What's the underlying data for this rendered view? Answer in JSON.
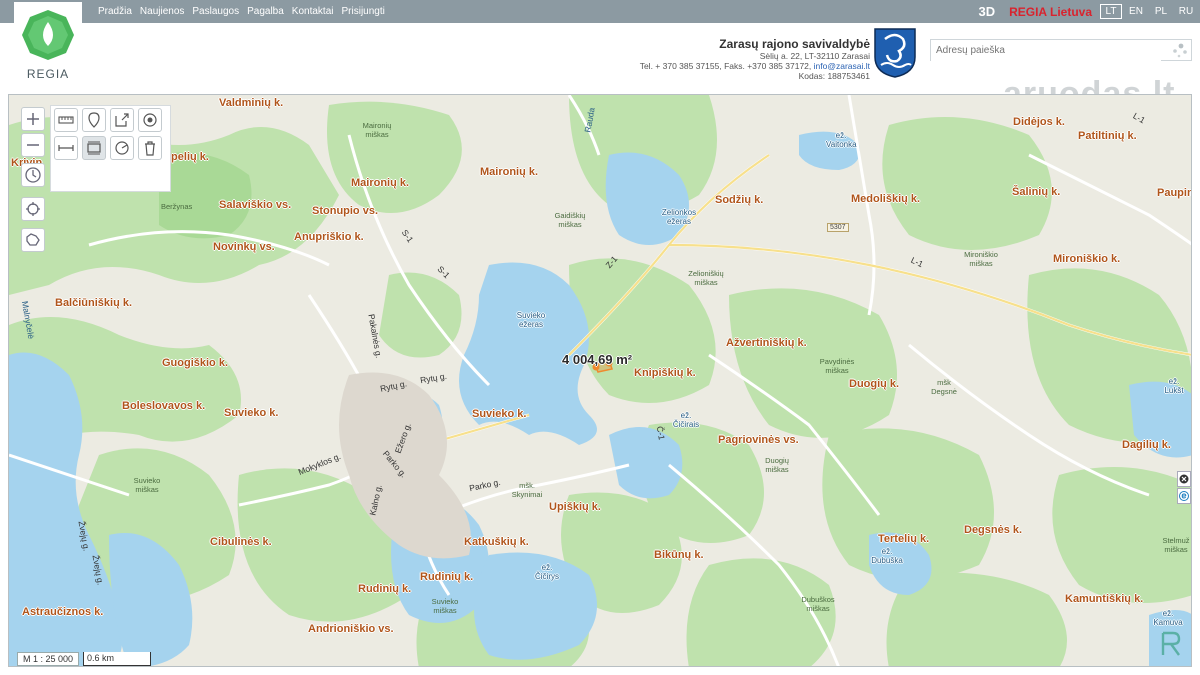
{
  "topbar": {
    "nav": [
      "Pradžia",
      "Naujienos",
      "Paslaugos",
      "Pagalba",
      "Kontaktai",
      "Prisijungti"
    ],
    "view_3d": "3D",
    "brand": "REGIA Lietuva",
    "languages": [
      "LT",
      "EN",
      "PL",
      "RU"
    ],
    "active_language": "LT"
  },
  "logo": {
    "text": "REGIA"
  },
  "municipality": {
    "name": "Zarasų rajono savivaldybė",
    "address": "Sėlių a. 22, LT-32110 Zarasai",
    "phone_prefix": "Tel. + 370 385 37155, Faks. +370 385 37172,",
    "email": "info@zarasai.lt",
    "code": "Kodas: 188753461"
  },
  "search": {
    "placeholder": "Adresų paieška"
  },
  "watermark": "aruodas.lt",
  "map": {
    "area_measurement": "4 004,69 m²",
    "scale_text": "M 1 : 25 000",
    "scale_bar": "0.6 km",
    "village_labels": [
      "Valdminių k.",
      "Krivin",
      "Pupelių k.",
      "Maironių k.",
      "Maironių k.",
      "Salaviškio vs.",
      "Stonupio vs.",
      "Novinkų vs.",
      "Anupriškio k.",
      "Sodžių k.",
      "Medoliškių k.",
      "Didėjos k.",
      "Patiltinių k.",
      "Šalinių k.",
      "Paupin",
      "Mironiškio k.",
      "Balčiūniškių k.",
      "Guogiškio k.",
      "Knipiškių k.",
      "Ažvertiniškių k.",
      "Duogių k.",
      "Boleslovavos k.",
      "Suvieko k.",
      "Suvieko k.",
      "Pagriovinės vs.",
      "Dagilių k.",
      "Upiškių k.",
      "Degsnės k.",
      "Tertelių k.",
      "Cibulinės k.",
      "Katkuškių k.",
      "Bikūnų k.",
      "Rudinių k.",
      "Rudinių k.",
      "Astraučiznos k.",
      "Andrioniškio vs.",
      "Kamuntiškių k."
    ],
    "water_labels": [
      "Suvieko ežeras",
      "Zelionkos ežeras",
      "ež. Vaitonka",
      "ež. Čičirais",
      "ež. Čičirys",
      "ež. Dubuška",
      "ež. Lukšt",
      "ež. Kamuva"
    ],
    "forest_labels": [
      "Maironių miškas",
      "Gaidiškių miškas",
      "Zelioniškių miškas",
      "Beržynas",
      "Mironiškio miškas",
      "Pavydinės miškas",
      "mšk Degsnė",
      "Duogių miškas",
      "mšk. Skynimai",
      "Suvieko miškas",
      "Suvieko miškas",
      "Dubuškos miškas",
      "Stelmuž miškas"
    ],
    "road_labels": [
      "Pakalnės g.",
      "Rytų g.",
      "Rytų g.",
      "Ežero g.",
      "Parko g.",
      "Mokyklos g.",
      "Kalno g.",
      "Parko g.",
      "Žvejų g.",
      "Žvejų g.",
      "Malnyčelė",
      "Rauda",
      "S-1",
      "S-1",
      "Z-1",
      "L-1",
      "L-1",
      "Č-1"
    ],
    "road_number": "5307"
  },
  "colors": {
    "topbar": "#8c9aa2",
    "water": "#a5d3ee",
    "forest": "#bfe2ad",
    "village_label": "#b0551b",
    "brand_red": "#d9232e",
    "measure_marker": "#ef8a2e"
  }
}
